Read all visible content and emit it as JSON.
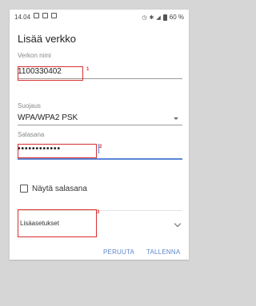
{
  "status_bar": {
    "time": "14.04",
    "battery_percent": "60 %",
    "left_icons": [
      "notification-icon",
      "image-icon",
      "sim-icon"
    ],
    "right_icons": [
      "alarm-icon",
      "bluetooth-icon",
      "signal-icon",
      "battery-icon"
    ]
  },
  "dialog": {
    "title": "Lisää verkko",
    "network_name": {
      "label": "Verkon nimi",
      "value": "1100330402"
    },
    "security": {
      "label": "Suojaus",
      "value": "WPA/WPA2 PSK"
    },
    "password": {
      "label": "Salasana",
      "value": "••••••••••••"
    },
    "show_password": {
      "label": "Näytä salasana",
      "checked": false
    },
    "advanced": {
      "label": "Lisäasetukset"
    },
    "buttons": {
      "cancel": "PERUUTA",
      "save": "TALLENNA"
    }
  },
  "annotations": {
    "marker_1": "1",
    "marker_2": "2",
    "marker_3": "3"
  },
  "colors": {
    "accent": "#5d86cf",
    "annotation": "#d93030",
    "background": "#d6d6d6"
  }
}
